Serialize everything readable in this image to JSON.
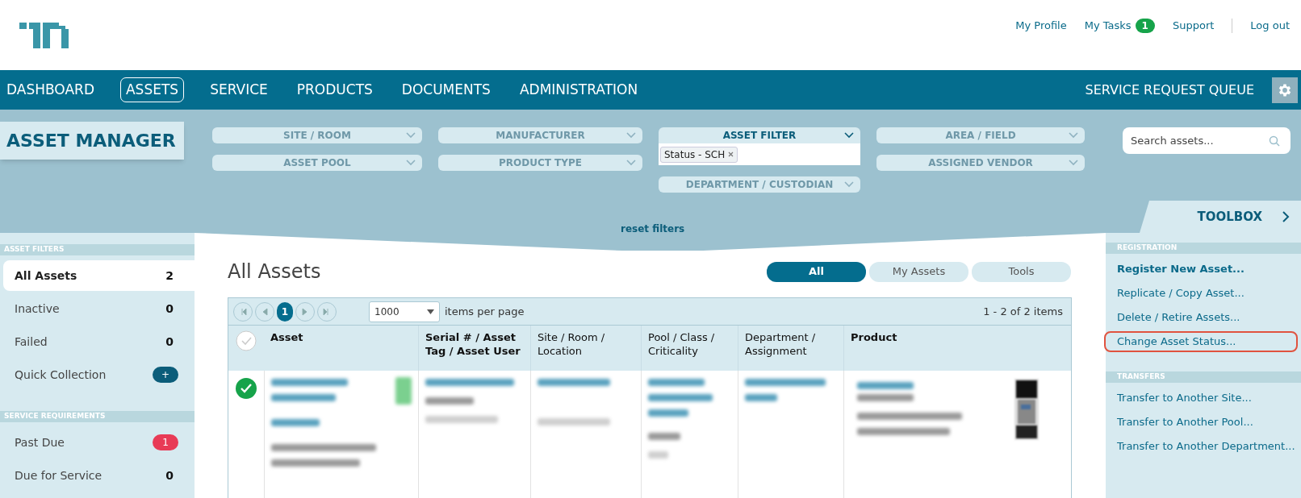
{
  "header": {
    "links": [
      {
        "label": "My Profile"
      },
      {
        "label": "My Tasks",
        "badge": "1"
      },
      {
        "label": "Support"
      },
      {
        "label": "Log out"
      }
    ]
  },
  "nav": {
    "items": [
      {
        "label": "DASHBOARD",
        "selected": false
      },
      {
        "label": "ASSETS",
        "selected": true
      },
      {
        "label": "SERVICE",
        "selected": false
      },
      {
        "label": "PRODUCTS",
        "selected": false
      },
      {
        "label": "DOCUMENTS",
        "selected": false
      },
      {
        "label": "ADMINISTRATION",
        "selected": false
      }
    ],
    "right_label": "SERVICE REQUEST QUEUE"
  },
  "filters": {
    "title": "ASSET MANAGER",
    "dropdowns": [
      {
        "label": "SITE / ROOM",
        "active": false
      },
      {
        "label": "ASSET POOL",
        "active": false
      },
      {
        "label": "MANUFACTURER",
        "active": false
      },
      {
        "label": "PRODUCT TYPE",
        "active": false
      },
      {
        "label": "ASSET FILTER",
        "active": true,
        "tags": [
          "Status - SCH"
        ]
      },
      {
        "label": "DEPARTMENT / CUSTODIAN",
        "active": false
      },
      {
        "label": "AREA / FIELD",
        "active": false
      },
      {
        "label": "ASSIGNED VENDOR",
        "active": false
      }
    ],
    "search_placeholder": "Search assets...",
    "reset": "reset filters",
    "toolbox": "TOOLBOX"
  },
  "sidebar": {
    "sections": [
      {
        "title": "ASSET FILTERS",
        "items": [
          {
            "label": "All Assets",
            "count": "2",
            "selected": true
          },
          {
            "label": "Inactive",
            "count": "0",
            "selected": false
          },
          {
            "label": "Failed",
            "count": "0",
            "selected": false
          },
          {
            "label": "Quick Collection",
            "count": "+",
            "kind": "add",
            "selected": false
          }
        ]
      },
      {
        "title": "SERVICE REQUIREMENTS",
        "items": [
          {
            "label": "Past Due",
            "count": "1",
            "kind": "alert",
            "selected": false
          },
          {
            "label": "Due for Service",
            "count": "0",
            "selected": false
          }
        ]
      }
    ]
  },
  "main": {
    "title": "All Assets",
    "tabs": [
      {
        "label": "All",
        "selected": true
      },
      {
        "label": "My Assets",
        "selected": false
      },
      {
        "label": "Tools",
        "selected": false
      }
    ],
    "pager": {
      "page": "1",
      "page_size": "1000",
      "per_page_label": "items per page",
      "range": "1 - 2 of 2 items"
    },
    "table": {
      "columns": [
        {
          "label": "Asset",
          "bold": true
        },
        {
          "label": "Serial # / Asset Tag / Asset User",
          "bold": true
        },
        {
          "label": "Site / Room / Location",
          "bold": false
        },
        {
          "label": "Pool / Class / Criticality",
          "bold": false
        },
        {
          "label": "Department / Assignment",
          "bold": false
        },
        {
          "label": "Product",
          "bold": true
        }
      ],
      "all_selected": false,
      "rows": [
        {
          "checked": true
        }
      ]
    }
  },
  "toolbox": {
    "sections": [
      {
        "title": "REGISTRATION",
        "items": [
          {
            "label": "Register New Asset...",
            "bold": true,
            "highlighted": false
          },
          {
            "label": "Replicate / Copy Asset...",
            "bold": false,
            "highlighted": false
          },
          {
            "label": "Delete / Retire Assets...",
            "bold": false,
            "highlighted": false
          },
          {
            "label": "Change Asset Status...",
            "bold": false,
            "highlighted": true
          }
        ]
      },
      {
        "title": "TRANSFERS",
        "items": [
          {
            "label": "Transfer to Another Site...",
            "bold": false,
            "highlighted": false
          },
          {
            "label": "Transfer to Another Pool...",
            "bold": false,
            "highlighted": false
          },
          {
            "label": "Transfer to Another Department...",
            "bold": false,
            "highlighted": false
          }
        ]
      }
    ]
  }
}
